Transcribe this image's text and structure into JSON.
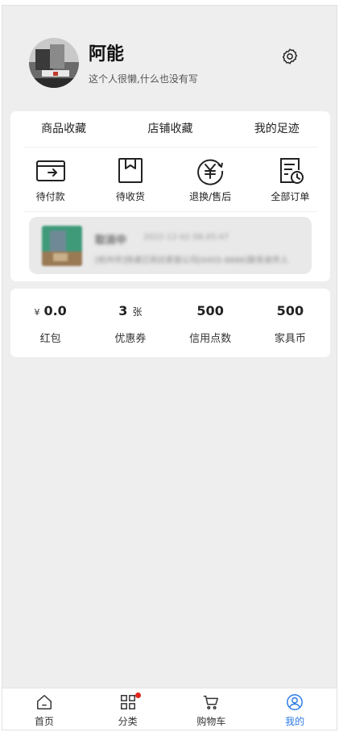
{
  "profile": {
    "name": "阿能",
    "bio": "这个人很懒,什么也没有写",
    "settings_icon": "gear-icon"
  },
  "shortcuts": [
    {
      "label": "商品收藏"
    },
    {
      "label": "店铺收藏"
    },
    {
      "label": "我的足迹"
    }
  ],
  "orders": [
    {
      "label": "待付款",
      "icon": "wallet-arrow-icon"
    },
    {
      "label": "待收货",
      "icon": "package-icon"
    },
    {
      "label": "退换/售后",
      "icon": "yen-return-icon"
    },
    {
      "label": "全部订单",
      "icon": "order-clock-icon"
    }
  ],
  "tracking": {
    "status": "取派中",
    "time": "2022-12-02 08:45:47",
    "description": "[杭州市]快递已到达家居公司[0455-8888]联系收件人"
  },
  "assets": [
    {
      "prefix": "¥",
      "value": "0.0",
      "suffix": "",
      "label": "红包"
    },
    {
      "prefix": "",
      "value": "3",
      "suffix": "张",
      "label": "优惠券"
    },
    {
      "prefix": "",
      "value": "500",
      "suffix": "",
      "label": "信用点数"
    },
    {
      "prefix": "",
      "value": "500",
      "suffix": "",
      "label": "家具币"
    }
  ],
  "tabbar": [
    {
      "label": "首页",
      "icon": "home-icon",
      "active": false
    },
    {
      "label": "分类",
      "icon": "grid-icon",
      "active": false,
      "badge": true
    },
    {
      "label": "购物车",
      "icon": "cart-icon",
      "active": false
    },
    {
      "label": "我的",
      "icon": "user-icon",
      "active": true
    }
  ],
  "colors": {
    "background": "#eeeeee",
    "card": "#ffffff",
    "accent": "#2c7be5",
    "badge": "#e1251b"
  }
}
